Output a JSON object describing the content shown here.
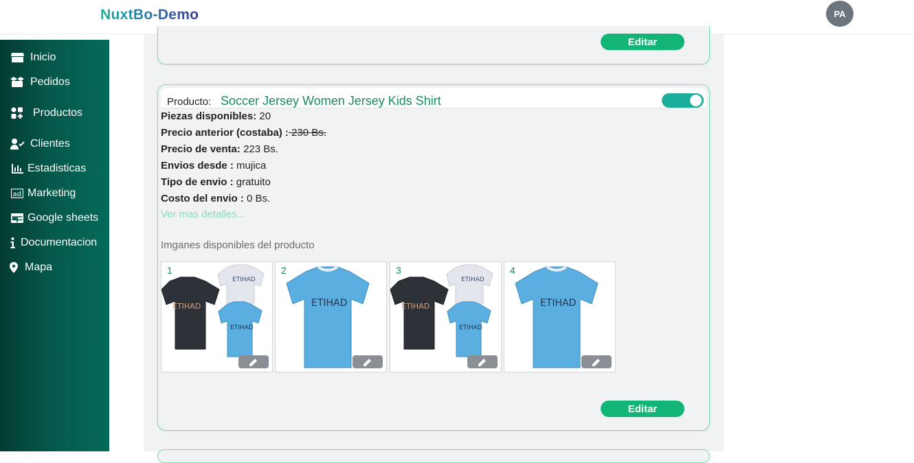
{
  "app": {
    "brand": "NuxtBo-Demo",
    "avatar_initials": "PA"
  },
  "sidebar": {
    "items": [
      {
        "label": "Inicio",
        "icon": "store-icon"
      },
      {
        "label": "Pedidos",
        "icon": "boxes-icon"
      },
      {
        "label": "Productos",
        "icon": "grid-icon"
      },
      {
        "label": "Clientes",
        "icon": "user-check-icon"
      },
      {
        "label": "Estadisticas",
        "icon": "bar-chart-icon"
      },
      {
        "label": "Marketing",
        "icon": "ad-icon"
      },
      {
        "label": "Google sheets",
        "icon": "table-icon"
      },
      {
        "label": "Documentacion",
        "icon": "info-icon"
      },
      {
        "label": "Mapa",
        "icon": "map-marker-icon"
      }
    ]
  },
  "prev_card": {
    "edit_label": "Editar"
  },
  "product": {
    "label": "Producto:",
    "name": "Soccer Jersey Women Jersey Kids Shirt",
    "active": true,
    "fields": {
      "stock_label": "Piezas disponibles:",
      "stock_value": "20",
      "old_price_label": "Precio anterior (costaba) :",
      "old_price_value": " 230 Bs.",
      "price_label": "Precio de venta:",
      "price_value": "223 Bs.",
      "ship_from_label": "Envios desde :",
      "ship_from_value": "mujica",
      "ship_type_label": "Tipo de envio :",
      "ship_type_value": "gratuito",
      "ship_cost_label": "Costo del envio :",
      "ship_cost_value": "0 Bs."
    },
    "more_link": "Ver mas detalles...",
    "images_title": "Imganes disponibles del producto",
    "images": [
      {
        "num": "1",
        "kind": "three-shirts"
      },
      {
        "num": "2",
        "kind": "light-blue-shirt"
      },
      {
        "num": "3",
        "kind": "three-shirts"
      },
      {
        "num": "4",
        "kind": "light-blue-shirt"
      }
    ],
    "edit_label": "Editar"
  },
  "colors": {
    "accent": "#12b575",
    "brand_green": "#1a8a64",
    "sidebar": "#05584a"
  }
}
